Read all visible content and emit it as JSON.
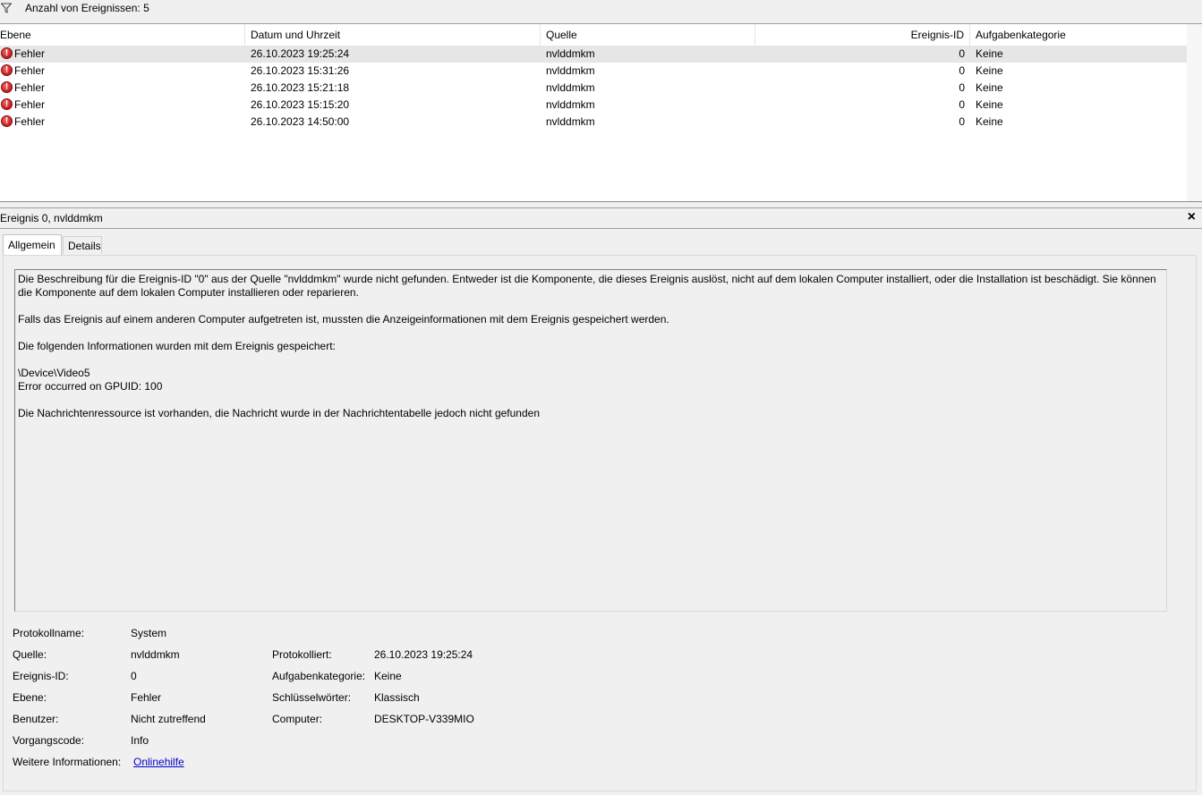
{
  "filter": {
    "icon": "filter-icon",
    "count_label": "Anzahl von Ereignissen: 5"
  },
  "columns": {
    "ebene": "Ebene",
    "datum": "Datum und Uhrzeit",
    "quelle": "Quelle",
    "id": "Ereignis-ID",
    "kategorie": "Aufgabenkategorie"
  },
  "events": [
    {
      "ebene": "Fehler",
      "datum": "26.10.2023 19:25:24",
      "quelle": "nvlddmkm",
      "id": "0",
      "kategorie": "Keine"
    },
    {
      "ebene": "Fehler",
      "datum": "26.10.2023 15:31:26",
      "quelle": "nvlddmkm",
      "id": "0",
      "kategorie": "Keine"
    },
    {
      "ebene": "Fehler",
      "datum": "26.10.2023 15:21:18",
      "quelle": "nvlddmkm",
      "id": "0",
      "kategorie": "Keine"
    },
    {
      "ebene": "Fehler",
      "datum": "26.10.2023 15:15:20",
      "quelle": "nvlddmkm",
      "id": "0",
      "kategorie": "Keine"
    },
    {
      "ebene": "Fehler",
      "datum": "26.10.2023 14:50:00",
      "quelle": "nvlddmkm",
      "id": "0",
      "kategorie": "Keine"
    }
  ],
  "detail": {
    "title": "Ereignis 0, nvlddmkm",
    "close": "×",
    "tabs": {
      "allgemein": "Allgemein",
      "details": "Details"
    },
    "description": {
      "p1": "Die Beschreibung für die Ereignis-ID \"0\" aus der Quelle \"nvlddmkm\" wurde nicht gefunden. Entweder ist die Komponente, die dieses Ereignis auslöst, nicht auf dem lokalen Computer installiert, oder die Installation ist beschädigt. Sie können die Komponente auf dem lokalen Computer installieren oder reparieren.",
      "p2": "Falls das Ereignis auf einem anderen Computer aufgetreten ist, mussten die Anzeigeinformationen mit dem Ereignis gespeichert werden.",
      "p3": "Die folgenden Informationen wurden mit dem Ereignis gespeichert:",
      "p4a": "\\Device\\Video5",
      "p4b": "Error occurred on GPUID: 100",
      "p5": "Die Nachrichtenressource ist vorhanden, die Nachricht wurde in der Nachrichtentabelle jedoch nicht gefunden"
    },
    "fields": {
      "protokollname_label": "Protokollname:",
      "protokollname_value": "System",
      "quelle_label": "Quelle:",
      "quelle_value": "nvlddmkm",
      "protokolliert_label": "Protokolliert:",
      "protokolliert_value": "26.10.2023 19:25:24",
      "ereignisid_label": "Ereignis-ID:",
      "ereignisid_value": "0",
      "aufgabenkategorie_label": "Aufgabenkategorie:",
      "aufgabenkategorie_value": "Keine",
      "ebene_label": "Ebene:",
      "ebene_value": "Fehler",
      "schluesselwoerter_label": "Schlüsselwörter:",
      "schluesselwoerter_value": "Klassisch",
      "benutzer_label": "Benutzer:",
      "benutzer_value": "Nicht zutreffend",
      "computer_label": "Computer:",
      "computer_value": "DESKTOP-V339MIO",
      "vorgangscode_label": "Vorgangscode:",
      "vorgangscode_value": "Info",
      "weitere_label": "Weitere Informationen:",
      "weitere_link": "Onlinehilfe"
    }
  }
}
